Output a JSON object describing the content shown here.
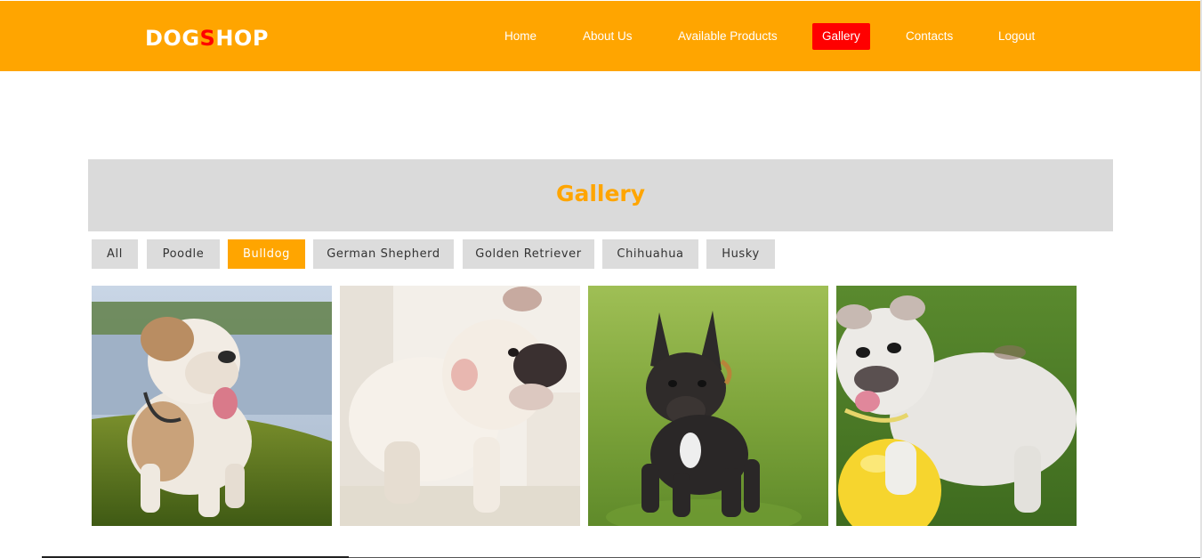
{
  "brand": {
    "part1": "DOG",
    "part2": "S",
    "part3": "HOP"
  },
  "nav": {
    "items": [
      {
        "label": "Home"
      },
      {
        "label": "About Us"
      },
      {
        "label": "Available Products"
      },
      {
        "label": "Gallery",
        "active": true
      },
      {
        "label": "Contacts"
      },
      {
        "label": "Logout"
      }
    ]
  },
  "gallery": {
    "title": "Gallery",
    "filters": [
      {
        "label": "All"
      },
      {
        "label": "Poodle"
      },
      {
        "label": "Bulldog",
        "active": true
      },
      {
        "label": "German Shepherd"
      },
      {
        "label": "Golden Retriever"
      },
      {
        "label": "Chihuahua"
      },
      {
        "label": "Husky"
      }
    ],
    "photos": [
      {
        "subject": "english-bulldog-by-lake"
      },
      {
        "subject": "white-bulldog-on-couch"
      },
      {
        "subject": "black-french-bulldog-on-grass"
      },
      {
        "subject": "white-bulldog-with-yellow-ball"
      }
    ]
  },
  "colors": {
    "accent": "#ffa500",
    "active_nav": "#ff0000",
    "panel": "#dadada"
  }
}
